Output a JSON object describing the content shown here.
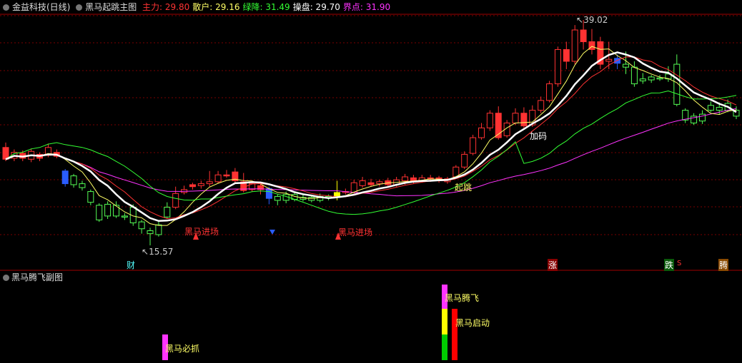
{
  "main_panel": {
    "stock_title": "金益科技(日线)",
    "indicator_title": "黑马起跳主图",
    "legend": [
      {
        "label": "主力:",
        "value": "29.80",
        "color": "#ff3333"
      },
      {
        "label": "散户:",
        "value": "29.16",
        "color": "#ffff66"
      },
      {
        "label": "绿降:",
        "value": "31.49",
        "color": "#33ff33"
      },
      {
        "label": "操盘:",
        "value": "29.70",
        "color": "#ffffff"
      },
      {
        "label": "界点:",
        "value": "31.90",
        "color": "#ff33ff"
      }
    ],
    "high_marker": "39.02",
    "low_marker": "15.57",
    "signal_labels": {
      "jump": "起跳",
      "add": "加码",
      "buy_1": "黑马进场",
      "buy_2": "黑马进场"
    },
    "bottom_markers": {
      "cai": "财",
      "zhang": "涨",
      "die": "跌",
      "s": "S",
      "teng": "腾"
    }
  },
  "sub_panel": {
    "title": "黑马腾飞副图",
    "labels": {
      "must_catch": "黑马必抓",
      "fly": "黑马腾飞",
      "start": "黑马启动"
    }
  },
  "colors": {
    "up": "#ff3232",
    "down": "#54fcfc",
    "green_candle": "#54fc54",
    "grid": "#8b0000",
    "axis": "#a00000"
  },
  "chart_data": {
    "type": "candlestick",
    "y_range": [
      15.57,
      39.02
    ],
    "candles": [
      [
        26.0,
        24.8,
        26.5,
        24.6
      ],
      [
        24.9,
        25.5,
        25.8,
        24.6
      ],
      [
        25.4,
        24.9,
        25.7,
        24.6
      ],
      [
        24.8,
        25.6,
        25.9,
        24.5
      ],
      [
        25.3,
        24.9,
        25.5,
        24.6
      ],
      [
        25.2,
        26.0,
        26.4,
        25.0
      ],
      [
        25.5,
        25.1,
        25.8,
        24.9
      ],
      [
        23.6,
        22.3,
        23.8,
        22.0
      ],
      [
        23.1,
        22.2,
        23.3,
        21.9
      ],
      [
        22.3,
        21.9,
        22.6,
        21.6
      ],
      [
        21.5,
        20.4,
        21.7,
        20.1
      ],
      [
        20.1,
        18.6,
        20.3,
        18.4
      ],
      [
        19.0,
        20.2,
        20.5,
        18.7
      ],
      [
        20.1,
        19.0,
        20.5,
        18.8
      ],
      [
        19.0,
        18.9,
        19.3,
        18.6
      ],
      [
        19.9,
        18.3,
        20.2,
        18.0
      ],
      [
        18.4,
        17.7,
        18.6,
        17.2
      ],
      [
        17.5,
        17.2,
        17.8,
        16.0
      ],
      [
        17.1,
        18.1,
        18.4,
        16.9
      ],
      [
        19.9,
        18.9,
        20.4,
        18.7
      ],
      [
        19.9,
        21.3,
        22.0,
        19.7
      ],
      [
        21.4,
        21.7,
        22.1,
        21.2
      ],
      [
        22.2,
        22.0,
        22.4,
        21.7
      ],
      [
        22.1,
        22.3,
        22.6,
        21.8
      ],
      [
        22.3,
        22.5,
        23.6,
        22.0
      ],
      [
        22.5,
        23.2,
        23.6,
        22.3
      ],
      [
        23.2,
        23.2,
        23.7,
        22.9
      ],
      [
        23.5,
        22.6,
        23.9,
        22.3
      ],
      [
        22.5,
        21.6,
        23.4,
        21.4
      ],
      [
        21.7,
        22.3,
        22.5,
        21.5
      ],
      [
        22.1,
        21.7,
        22.4,
        21.2
      ],
      [
        21.8,
        20.8,
        22.0,
        20.2
      ],
      [
        21.0,
        20.6,
        21.2,
        20.1
      ],
      [
        20.6,
        21.2,
        21.5,
        20.3
      ],
      [
        21.2,
        20.7,
        21.4,
        20.5
      ],
      [
        20.7,
        20.9,
        21.3,
        20.5
      ],
      [
        20.9,
        20.6,
        21.1,
        20.4
      ],
      [
        20.6,
        21.0,
        21.3,
        20.4
      ],
      [
        21.0,
        20.9,
        21.2,
        20.6
      ],
      [
        20.9,
        21.4,
        22.6,
        20.6
      ],
      [
        21.4,
        21.5,
        21.8,
        21.2
      ],
      [
        21.4,
        22.4,
        22.7,
        21.2
      ],
      [
        22.1,
        22.6,
        23.0,
        21.9
      ],
      [
        22.4,
        22.2,
        22.8,
        22.0
      ],
      [
        22.3,
        22.5,
        22.7,
        22.0
      ],
      [
        22.6,
        22.2,
        22.9,
        21.9
      ],
      [
        22.2,
        22.7,
        23.0,
        22.0
      ],
      [
        22.6,
        23.0,
        23.3,
        22.2
      ],
      [
        22.9,
        22.5,
        23.2,
        22.3
      ],
      [
        22.6,
        22.9,
        23.2,
        22.4
      ],
      [
        22.9,
        22.8,
        23.2,
        22.5
      ],
      [
        22.9,
        22.6,
        23.1,
        22.4
      ],
      [
        22.5,
        22.8,
        23.0,
        22.3
      ],
      [
        23.0,
        24.0,
        24.2,
        22.8
      ],
      [
        24.0,
        25.3,
        25.6,
        23.8
      ],
      [
        25.4,
        27.0,
        27.3,
        25.2
      ],
      [
        27.0,
        28.0,
        28.5,
        26.8
      ],
      [
        28.0,
        29.5,
        29.8,
        27.7
      ],
      [
        29.5,
        27.0,
        30.2,
        26.8
      ],
      [
        27.2,
        28.5,
        28.8,
        27.0
      ],
      [
        28.5,
        29.5,
        30.0,
        28.3
      ],
      [
        29.5,
        28.2,
        30.1,
        27.9
      ],
      [
        28.3,
        29.8,
        30.3,
        28.1
      ],
      [
        29.8,
        30.8,
        31.2,
        29.5
      ],
      [
        30.8,
        32.5,
        32.8,
        30.6
      ],
      [
        32.5,
        36.0,
        36.3,
        32.2
      ],
      [
        36.0,
        34.8,
        36.8,
        34.0
      ],
      [
        34.8,
        38.0,
        38.5,
        34.5
      ],
      [
        38.0,
        36.8,
        39.02,
        36.0
      ],
      [
        36.8,
        36.0,
        38.1,
        35.5
      ],
      [
        36.8,
        34.5,
        37.3,
        34.0
      ],
      [
        34.8,
        35.0,
        36.8,
        34.0
      ],
      [
        35.1,
        34.6,
        35.5,
        34.0
      ],
      [
        34.5,
        34.2,
        35.8,
        33.5
      ],
      [
        34.2,
        32.5,
        34.8,
        32.2
      ],
      [
        32.8,
        33.0,
        33.6,
        32.5
      ],
      [
        32.9,
        33.2,
        33.4,
        32.6
      ],
      [
        33.1,
        33.0,
        33.4,
        32.8
      ],
      [
        33.0,
        33.5,
        34.3,
        32.7
      ],
      [
        34.5,
        30.4,
        35.5,
        30.2
      ],
      [
        29.8,
        28.8,
        30.0,
        28.5
      ],
      [
        29.2,
        28.5,
        29.5,
        28.3
      ],
      [
        28.7,
        29.4,
        29.8,
        28.4
      ],
      [
        29.8,
        30.3,
        30.7,
        29.6
      ],
      [
        30.1,
        29.8,
        30.6,
        29.4
      ],
      [
        29.8,
        30.5,
        30.9,
        29.6
      ],
      [
        29.8,
        29.2,
        30.2,
        28.9
      ]
    ],
    "candle_colors": [
      "up",
      "up",
      "up",
      "up",
      "up",
      "up",
      "up",
      "down_blue",
      "green",
      "green",
      "green",
      "green",
      "green",
      "green",
      "green",
      "green",
      "green",
      "green",
      "green",
      "green",
      "up",
      "up",
      "up",
      "up",
      "up",
      "up",
      "up",
      "up",
      "up",
      "up",
      "up",
      "down_blue",
      "green",
      "green",
      "green",
      "green",
      "green",
      "green",
      "green",
      "yellow",
      "up",
      "up",
      "up",
      "up",
      "up",
      "up",
      "up",
      "up",
      "up",
      "up",
      "up",
      "up",
      "up",
      "up",
      "up",
      "up",
      "up",
      "up",
      "up",
      "up",
      "up",
      "up",
      "up",
      "up",
      "up",
      "up",
      "up",
      "up",
      "up",
      "up",
      "up",
      "up",
      "down_blue",
      "green",
      "green",
      "green",
      "green",
      "green",
      "green",
      "green",
      "green",
      "green",
      "green",
      "green",
      "green",
      "green",
      "green"
    ],
    "sub_bars": [
      {
        "name": "黑马必抓",
        "index": 0,
        "color": "#ff33ff"
      },
      {
        "name": "黑马腾飞",
        "index": 1,
        "color": "#ff33ff"
      },
      {
        "name": "黑马启动",
        "index": 2,
        "color": "#ff0000"
      }
    ]
  }
}
